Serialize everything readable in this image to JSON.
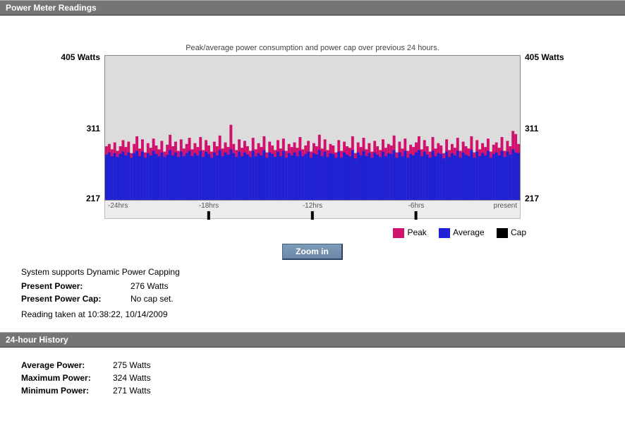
{
  "section1": {
    "title": "Power Meter Readings",
    "chart_caption": "Peak/average power consumption and power cap over previous 24 hours.",
    "y_top": "405 Watts",
    "y_mid": "311",
    "y_bot": "217",
    "x_ticks": [
      "-24hrs",
      "-18hrs",
      "-12hrs",
      "-6hrs",
      "present"
    ],
    "legend": {
      "peak": "Peak",
      "average": "Average",
      "cap": "Cap"
    },
    "zoom_label": "Zoom in",
    "support_line": "System supports Dynamic Power Capping",
    "present_power": {
      "label": "Present Power:",
      "value": "276 Watts"
    },
    "present_cap": {
      "label": "Present Power Cap:",
      "value": "No cap set."
    },
    "reading_line": "Reading taken at 10:38:22, 10/14/2009"
  },
  "section2": {
    "title": "24-hour History",
    "avg": {
      "label": "Average Power:",
      "value": "275 Watts"
    },
    "max": {
      "label": "Maximum Power:",
      "value": "324 Watts"
    },
    "min": {
      "label": "Minimum Power:",
      "value": "271 Watts"
    }
  },
  "colors": {
    "peak": "#d1116e",
    "average": "#1e22d4",
    "cap": "#000000"
  },
  "chart_data": {
    "type": "area",
    "title": "Peak/average power consumption and power cap over previous 24 hours.",
    "xlabel": "",
    "ylabel": "Watts",
    "ylim": [
      217,
      405
    ],
    "x": [
      "-24hrs",
      "-18hrs",
      "-12hrs",
      "-6hrs",
      "present"
    ],
    "series": [
      {
        "name": "Peak",
        "color": "#d1116e",
        "values": [
          287,
          290,
          283,
          292,
          281,
          287,
          295,
          286,
          293,
          278,
          290,
          300,
          284,
          296,
          279,
          291,
          285,
          297,
          288,
          283,
          294,
          280,
          289,
          302,
          287,
          293,
          281,
          296,
          284,
          290,
          298,
          283,
          291,
          286,
          299,
          282,
          295,
          288,
          280,
          293,
          287,
          301,
          284,
          292,
          286,
          315,
          290,
          282,
          296,
          285,
          294,
          287,
          281,
          298,
          283,
          291,
          286,
          300,
          279,
          293,
          288,
          282,
          295,
          284,
          297,
          281,
          290,
          286,
          292,
          285,
          299,
          283,
          288,
          294,
          280,
          291,
          287,
          302,
          284,
          296,
          282,
          290,
          288,
          279,
          295,
          281,
          293,
          287,
          285,
          300,
          278,
          292,
          286,
          298,
          283,
          291,
          280,
          294,
          287,
          282,
          296,
          285,
          290,
          288,
          301,
          279,
          293,
          284,
          297,
          281,
          289,
          286,
          292,
          300,
          283,
          295,
          287,
          280,
          299,
          284,
          291,
          288,
          278,
          296,
          282,
          290,
          285,
          298,
          281,
          293,
          287,
          284,
          300,
          279,
          295,
          283,
          291,
          286,
          297,
          280,
          289,
          292,
          285,
          299,
          281,
          294,
          287,
          307,
          303,
          290
        ]
      },
      {
        "name": "Average",
        "color": "#1e22d4",
        "values": [
          276,
          279,
          274,
          278,
          273,
          277,
          280,
          275,
          279,
          272,
          278,
          281,
          274,
          280,
          272,
          278,
          275,
          281,
          277,
          274,
          279,
          273,
          276,
          282,
          275,
          279,
          273,
          280,
          274,
          278,
          281,
          274,
          278,
          275,
          281,
          273,
          280,
          277,
          272,
          279,
          275,
          282,
          274,
          279,
          276,
          283,
          278,
          273,
          280,
          274,
          279,
          276,
          273,
          281,
          274,
          278,
          275,
          282,
          272,
          279,
          277,
          273,
          280,
          274,
          281,
          272,
          278,
          275,
          279,
          274,
          281,
          274,
          277,
          280,
          272,
          278,
          276,
          282,
          274,
          280,
          273,
          278,
          277,
          272,
          280,
          272,
          279,
          276,
          274,
          282,
          271,
          279,
          275,
          281,
          274,
          278,
          272,
          279,
          276,
          273,
          280,
          274,
          278,
          277,
          282,
          272,
          279,
          274,
          281,
          272,
          277,
          275,
          279,
          282,
          274,
          280,
          276,
          272,
          281,
          274,
          278,
          277,
          271,
          280,
          273,
          278,
          275,
          281,
          272,
          279,
          276,
          274,
          282,
          272,
          280,
          274,
          278,
          275,
          281,
          272,
          277,
          279,
          275,
          281,
          273,
          280,
          276,
          283,
          279,
          278
        ]
      },
      {
        "name": "Cap",
        "color": "#000000",
        "values": []
      }
    ],
    "legend_position": "bottom-right"
  }
}
